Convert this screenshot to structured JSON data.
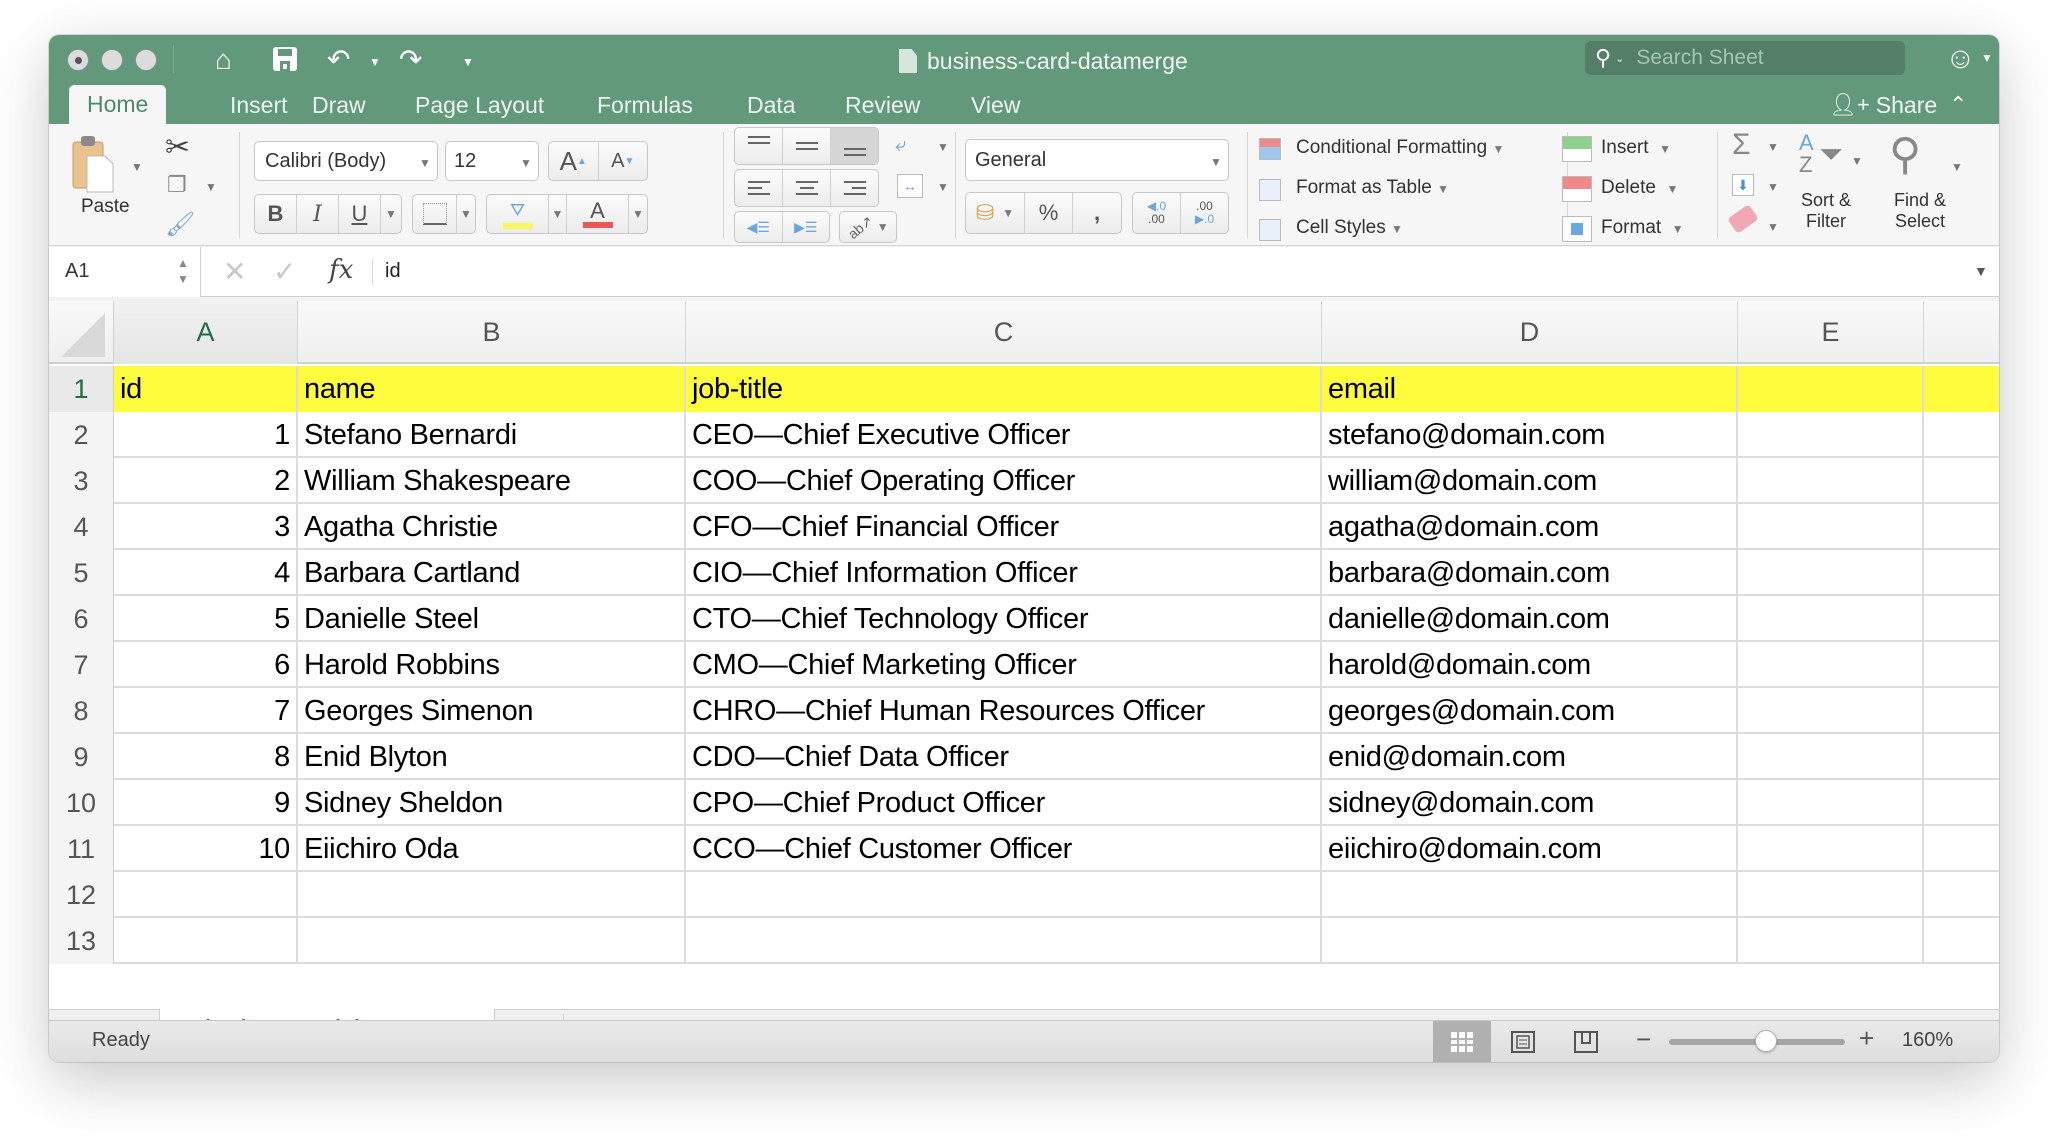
{
  "window": {
    "title": "business-card-datamerge",
    "search_placeholder": "Search Sheet"
  },
  "quick_access": {
    "icons": [
      "home-icon",
      "save-icon",
      "undo-icon",
      "redo-icon",
      "customize-toolbar-icon"
    ]
  },
  "tabs": [
    {
      "label": "Home",
      "active": true
    },
    {
      "label": "Insert"
    },
    {
      "label": "Draw"
    },
    {
      "label": "Page Layout"
    },
    {
      "label": "Formulas"
    },
    {
      "label": "Data"
    },
    {
      "label": "Review"
    },
    {
      "label": "View"
    }
  ],
  "share_label": "Share",
  "ribbon": {
    "paste_label": "Paste",
    "font_name": "Calibri (Body)",
    "font_size": "12",
    "bold": "B",
    "italic": "I",
    "underline": "U",
    "number_format": "General",
    "percent": "%",
    "comma": ",",
    "increase_decimal": ".00",
    "decrease_decimal": ".0",
    "conditional_formatting": "Conditional Formatting",
    "format_as_table": "Format as Table",
    "cell_styles": "Cell Styles",
    "insert": "Insert",
    "delete": "Delete",
    "format": "Format",
    "sort_filter_line1": "Sort &",
    "sort_filter_line2": "Filter",
    "find_select_line1": "Find &",
    "find_select_line2": "Select",
    "highlight_color": "#fcf55f",
    "font_color": "#ec5757"
  },
  "formula_bar": {
    "name_box": "A1",
    "fx": "fx",
    "value": "id"
  },
  "sheet": {
    "columns": [
      "A",
      "B",
      "C",
      "D",
      "E"
    ],
    "selected_column": "A",
    "selected_row": "1",
    "header_fill": "#fefc3c",
    "rows": [
      {
        "n": "1",
        "cells": [
          "id",
          "name",
          "job-title",
          "email",
          ""
        ]
      },
      {
        "n": "2",
        "cells": [
          "1",
          "Stefano Bernardi",
          "CEO—Chief Executive Officer",
          "stefano@domain.com",
          ""
        ]
      },
      {
        "n": "3",
        "cells": [
          "2",
          "William Shakespeare",
          "COO—Chief Operating Officer",
          "william@domain.com",
          ""
        ]
      },
      {
        "n": "4",
        "cells": [
          "3",
          "Agatha Christie",
          "CFO—Chief Financial Officer",
          "agatha@domain.com",
          ""
        ]
      },
      {
        "n": "5",
        "cells": [
          "4",
          "Barbara Cartland",
          "CIO—Chief Information Officer",
          "barbara@domain.com",
          ""
        ]
      },
      {
        "n": "6",
        "cells": [
          "5",
          "Danielle Steel",
          "CTO—Chief Technology Officer",
          "danielle@domain.com",
          ""
        ]
      },
      {
        "n": "7",
        "cells": [
          "6",
          "Harold Robbins",
          "CMO—Chief Marketing Officer",
          "harold@domain.com",
          ""
        ]
      },
      {
        "n": "8",
        "cells": [
          "7",
          "Georges Simenon",
          "CHRO—Chief Human Resources Officer",
          "georges@domain.com",
          ""
        ]
      },
      {
        "n": "9",
        "cells": [
          "8",
          "Enid Blyton",
          "CDO—Chief Data Officer",
          "enid@domain.com",
          ""
        ]
      },
      {
        "n": "10",
        "cells": [
          "9",
          "Sidney Sheldon",
          "CPO—Chief Product Officer",
          "sidney@domain.com",
          ""
        ]
      },
      {
        "n": "11",
        "cells": [
          "10",
          "Eiichiro Oda",
          "CCO—Chief Customer Officer",
          "eiichiro@domain.com",
          ""
        ]
      },
      {
        "n": "12",
        "cells": [
          "",
          "",
          "",
          "",
          ""
        ]
      },
      {
        "n": "13",
        "cells": [
          "",
          "",
          "",
          "",
          ""
        ]
      }
    ]
  },
  "sheet_tabs": {
    "active": "business-card-datamerge",
    "add_label": "+"
  },
  "status_bar": {
    "status": "Ready",
    "zoom_level": "160%",
    "zoom_slider_fraction": 0.55,
    "active_view": "normal"
  }
}
